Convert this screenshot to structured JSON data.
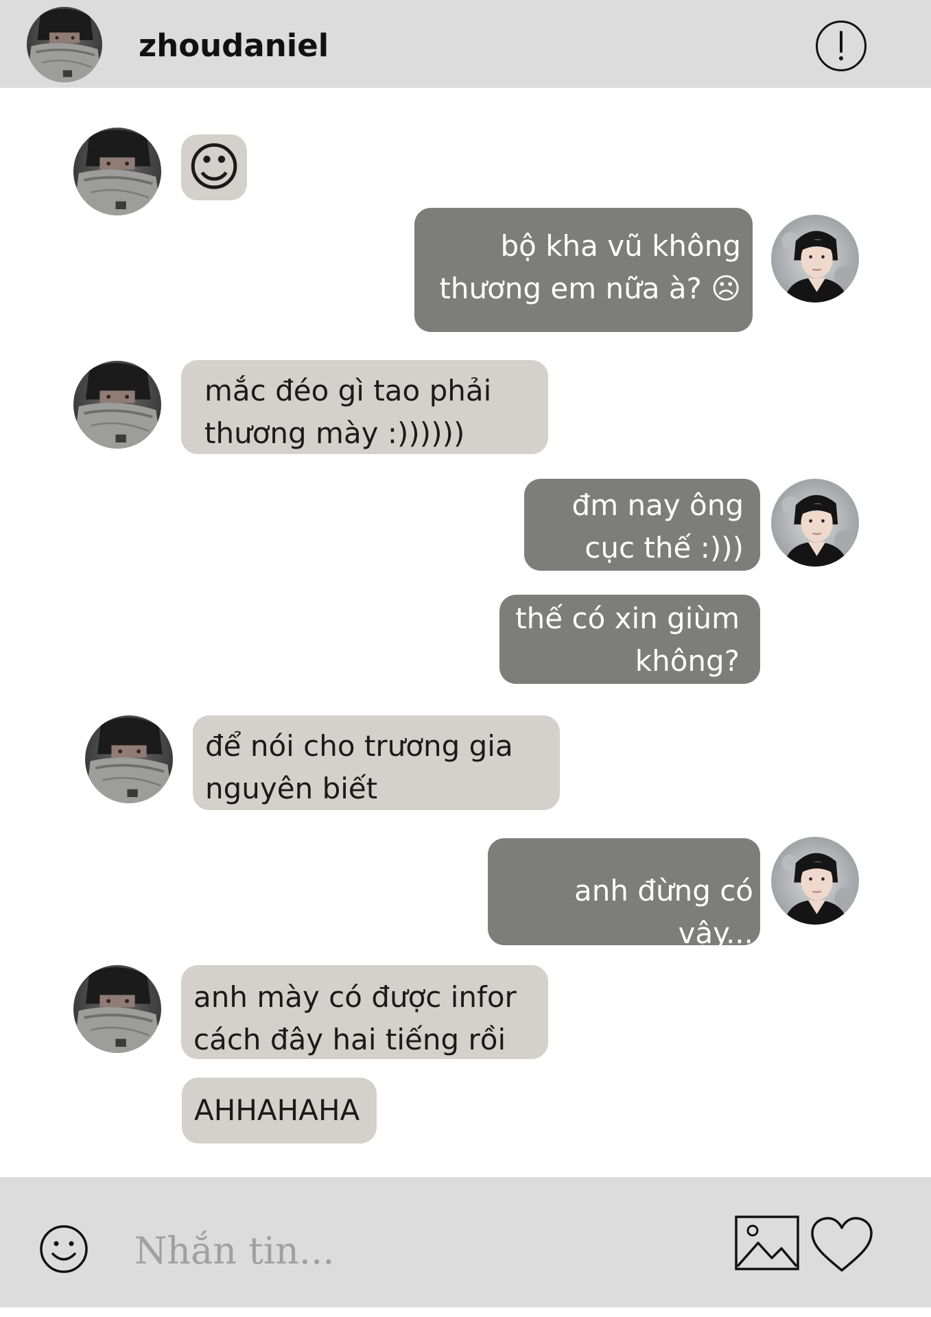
{
  "header": {
    "username": "zhoudaniel",
    "info_icon": "exclamation-circle-icon"
  },
  "messages": [
    {
      "side": "in",
      "text": "☺",
      "type": "emoji"
    },
    {
      "side": "out",
      "text": "bộ kha vũ không\nthương em nữa à? ☹"
    },
    {
      "side": "in",
      "text": "mắc đéo gì tao phải\nthương mày :))))))"
    },
    {
      "side": "out",
      "text": "đm nay ông\ncục thế :)))"
    },
    {
      "side": "out",
      "text": "thế có xin giùm\nkhông?"
    },
    {
      "side": "in",
      "text": "để nói cho trương gia\nnguyên biết"
    },
    {
      "side": "out",
      "text": "anh đừng có vậy..."
    },
    {
      "side": "in",
      "text": "anh mày có được infor\ncách đây hai tiếng rồi"
    },
    {
      "side": "in",
      "text": "AHHAHAHA"
    }
  ],
  "composer": {
    "placeholder": "Nhắn tin...",
    "emoji_icon": "smiley-icon",
    "image_icon": "image-icon",
    "heart_icon": "heart-icon"
  },
  "colors": {
    "header_bg": "#dcdcdc",
    "incoming_bubble": "#d4d0cb",
    "outgoing_bubble": "#7d7d7b",
    "outgoing_text": "#ffffff"
  }
}
